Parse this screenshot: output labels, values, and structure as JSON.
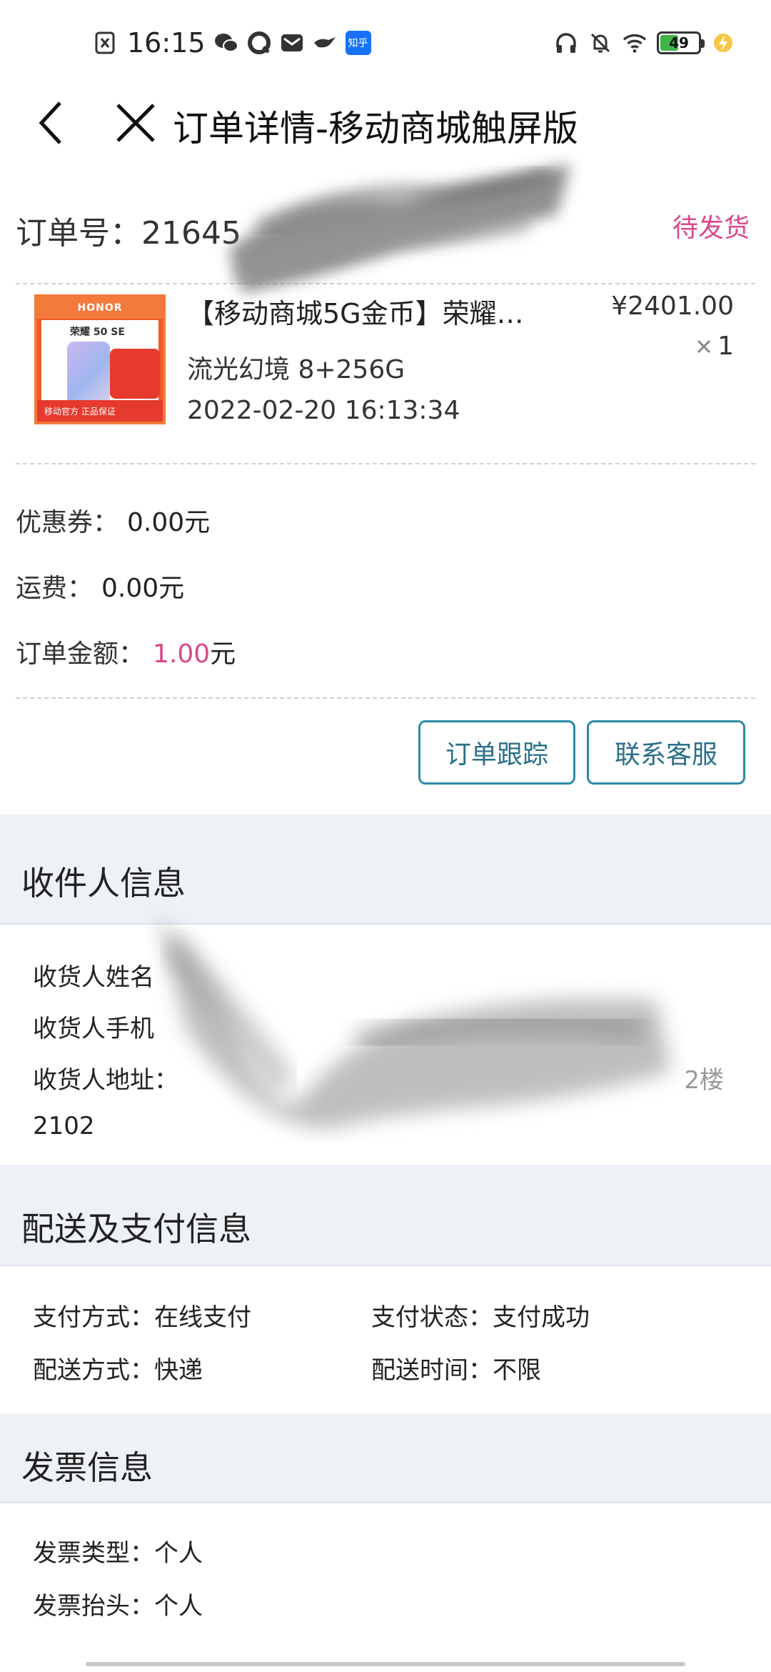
{
  "status_bar": {
    "time": "16:15",
    "battery": "49",
    "battery_level": 0.49,
    "zhihu_label": "知乎"
  },
  "header": {
    "title": "订单详情-移动商城触屏版"
  },
  "order": {
    "number_label": "订单号：",
    "number": "21645",
    "status": "待发货"
  },
  "product": {
    "name": "【移动商城5G金币】荣耀…",
    "price": "¥2401.00",
    "qty": "1",
    "spec": "流光幻境 8+256G",
    "time": "2022-02-20 16:13:34",
    "thumb_brand": "HONOR",
    "thumb_model": "荣耀 50 SE",
    "thumb_bottom": "移动官方 正品保证"
  },
  "summary": {
    "coupon_label": "优惠券：",
    "coupon_value": "0.00",
    "shipping_label": "运费：",
    "shipping_value": "0.00",
    "amount_label": "订单金额：",
    "amount_value": "1.00",
    "unit": "元"
  },
  "actions": {
    "track": "订单跟踪",
    "contact": "联系客服"
  },
  "receiver": {
    "title": "收件人信息",
    "name_label": "收货人姓名",
    "phone_label": "收货人手机",
    "address_label": "收货人地址：",
    "address_tail": "2楼",
    "address_line2": "2102"
  },
  "delivery": {
    "title": "配送及支付信息",
    "pay_method_label": "支付方式：",
    "pay_method": "在线支付",
    "pay_status_label": "支付状态：",
    "pay_status": "支付成功",
    "ship_method_label": "配送方式：",
    "ship_method": "快递",
    "ship_time_label": "配送时间：",
    "ship_time": "不限"
  },
  "invoice": {
    "title": "发票信息",
    "type_label": "发票类型：",
    "type": "个人",
    "header_label": "发票抬头：",
    "header": "个人"
  }
}
